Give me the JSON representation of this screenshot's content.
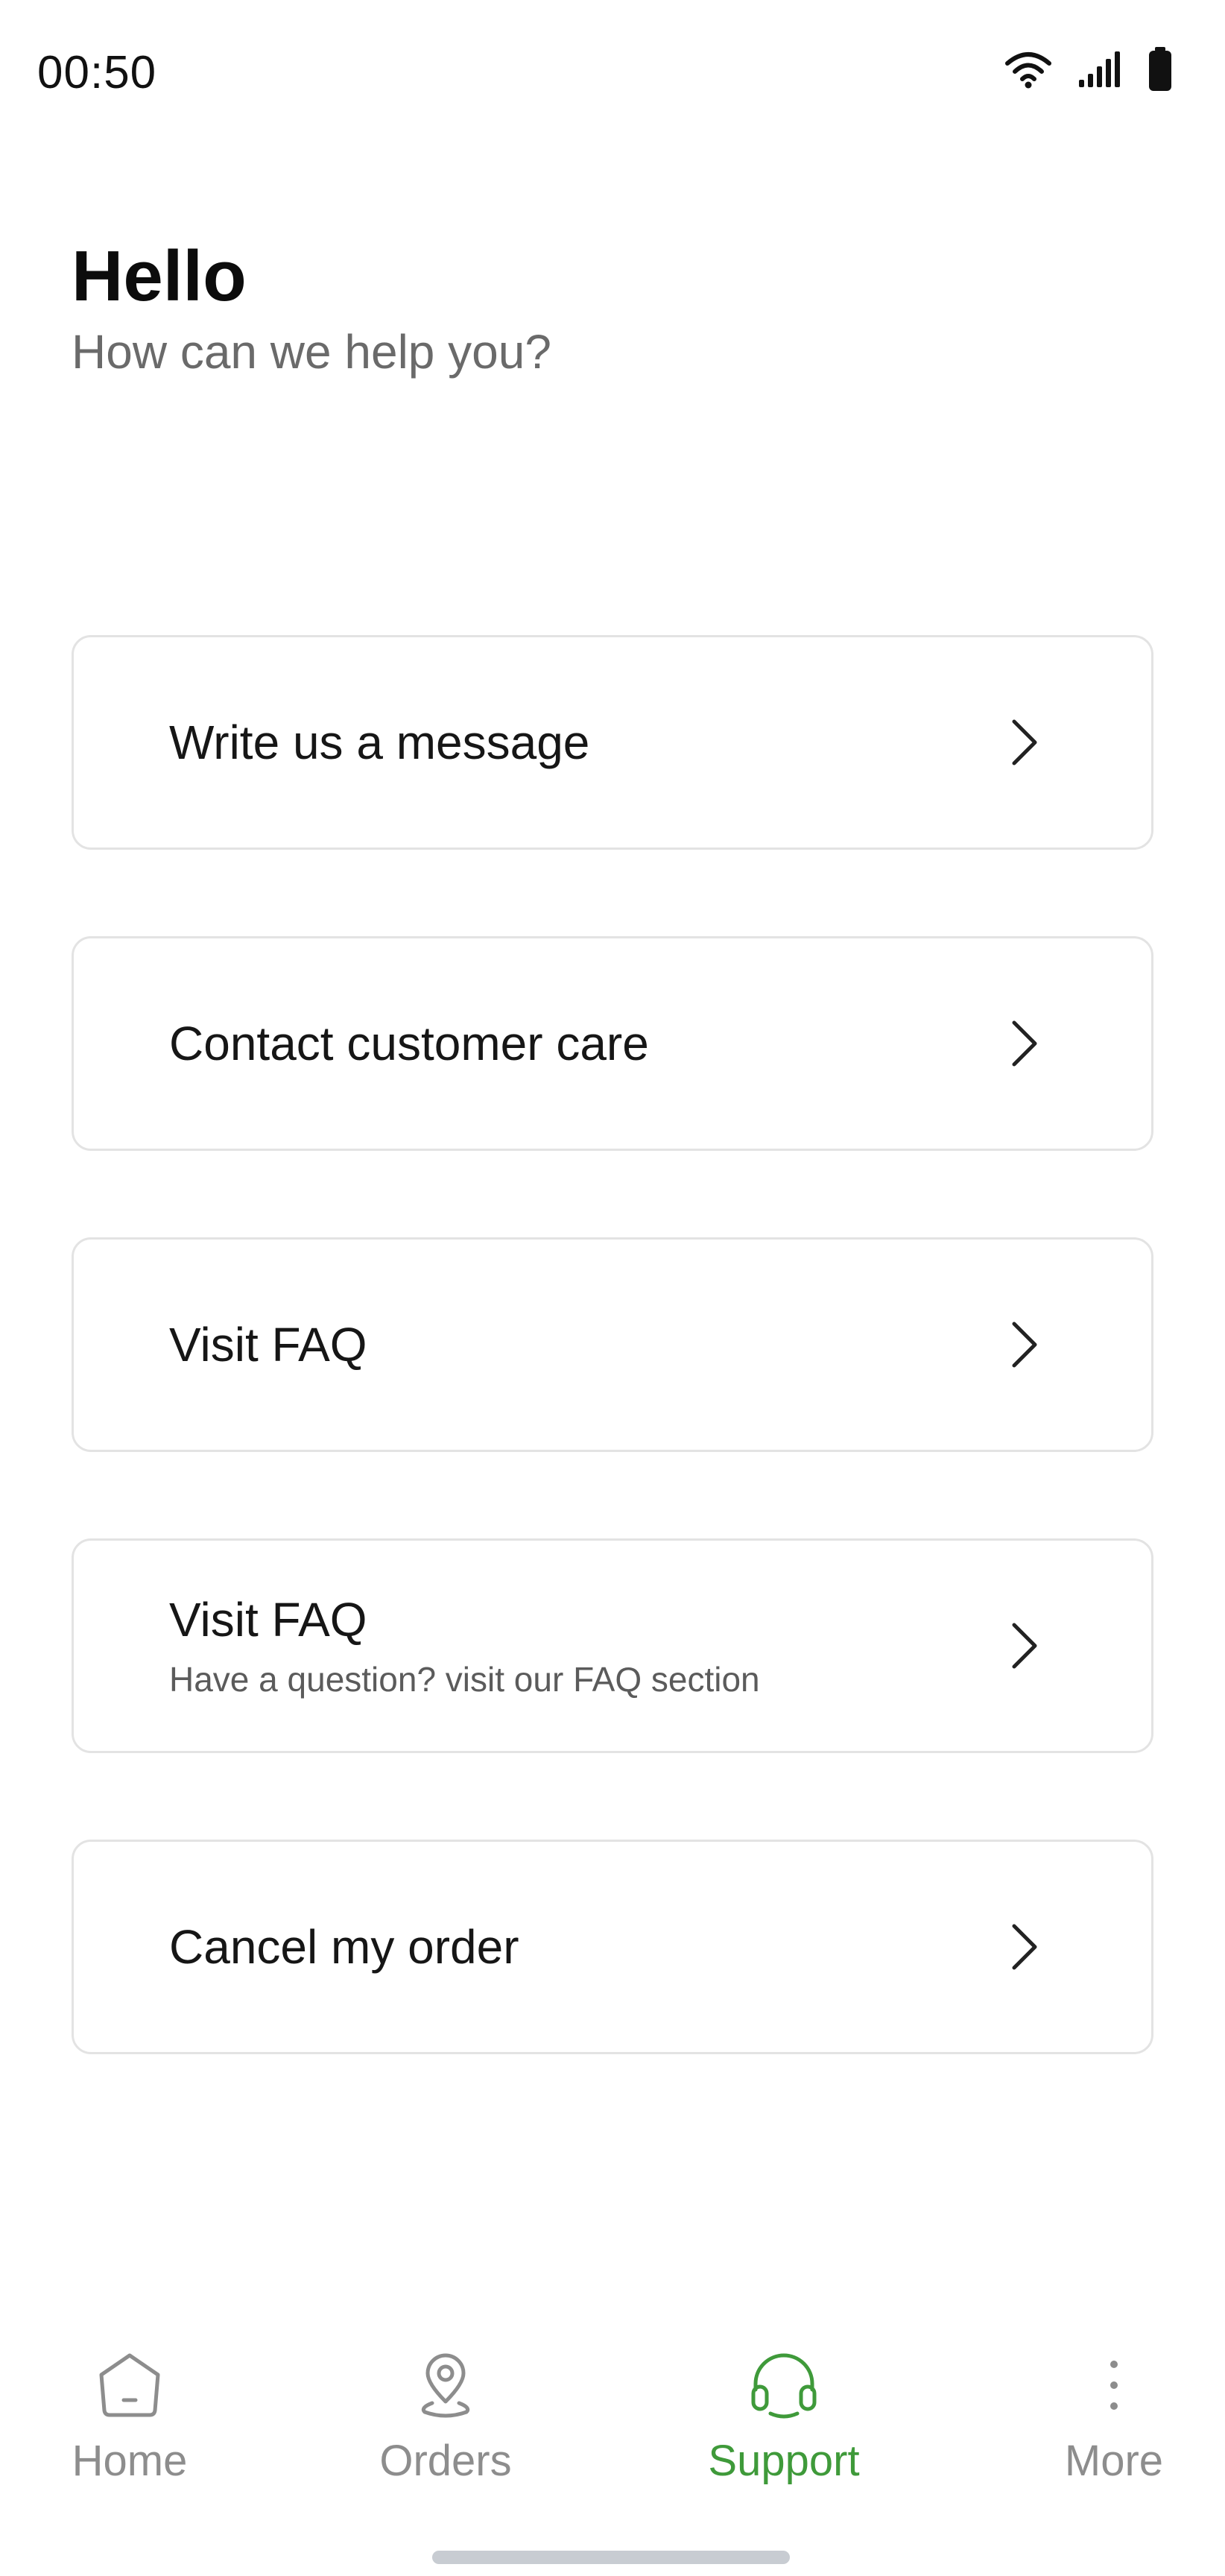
{
  "status_bar": {
    "time": "00:50",
    "icons": [
      "wifi-icon",
      "signal-icon",
      "battery-icon"
    ]
  },
  "header": {
    "title": "Hello",
    "subtitle": "How can we help you?"
  },
  "menu": {
    "items": [
      {
        "label": "Write us a message",
        "subtitle": "",
        "icon": "chevron-right-icon"
      },
      {
        "label": "Contact customer care",
        "subtitle": "",
        "icon": "chevron-right-icon"
      },
      {
        "label": "Visit FAQ",
        "subtitle": "",
        "icon": "chevron-right-icon"
      },
      {
        "label": "Visit FAQ",
        "subtitle": "Have a question? visit our FAQ section",
        "icon": "chevron-right-icon"
      },
      {
        "label": "Cancel my order",
        "subtitle": "",
        "icon": "chevron-right-icon"
      }
    ]
  },
  "bottom_nav": {
    "items": [
      {
        "label": "Home",
        "icon": "home-icon",
        "active": false
      },
      {
        "label": "Orders",
        "icon": "location-pin-icon",
        "active": false
      },
      {
        "label": "Support",
        "icon": "headset-icon",
        "active": true
      },
      {
        "label": "More",
        "icon": "more-vertical-icon",
        "active": false
      }
    ]
  },
  "colors": {
    "accent": "#3f9a3a",
    "inactive": "#8d8d8d",
    "card_border": "#e3e3e3",
    "text": "#111111",
    "subtitle": "#6a6a6a"
  }
}
